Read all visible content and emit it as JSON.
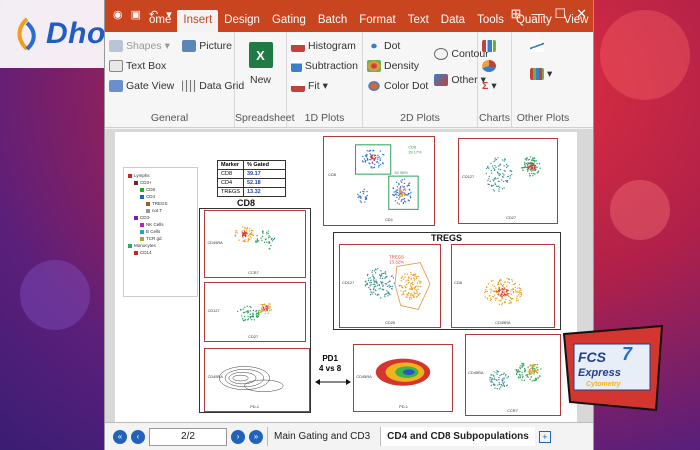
{
  "brand": {
    "name": "Dhorde"
  },
  "window": {
    "tabs": [
      "ome",
      "Insert",
      "Design",
      "Gating",
      "Batch",
      "Format",
      "Text",
      "Data",
      "Tools",
      "Quality",
      "View"
    ],
    "active_tab": "Insert",
    "controls": {
      "restore": "⊞",
      "minimize": "—",
      "maximize": "☐",
      "close": "✕"
    }
  },
  "ribbon": {
    "general": {
      "label": "General",
      "shapes": "Shapes",
      "picture": "Picture",
      "text_box": "Text Box",
      "gate_view": "Gate View",
      "data_grid": "Data Grid"
    },
    "spreadsheet": {
      "label": "Spreadsheet",
      "new": "New"
    },
    "plots1d": {
      "label": "1D Plots",
      "histogram": "Histogram",
      "subtraction": "Subtraction",
      "fit": "Fit"
    },
    "plots2d": {
      "label": "2D Plots",
      "dot": "Dot",
      "density": "Density",
      "color_dot": "Color Dot",
      "contour": "Contour",
      "other": "Other"
    },
    "charts": {
      "label": "Charts"
    },
    "other_plots": {
      "label": "Other Plots"
    }
  },
  "layout_page": {
    "tree_items": [
      "Lymphs",
      "CD3+",
      "CD8",
      "CD4",
      "TREGS",
      "not T",
      "CD3-",
      "NK Cells",
      "B Cells",
      "TCR gd",
      "Monocytes",
      "CD14"
    ],
    "stats_table": {
      "headers": [
        "Marker",
        "% Gated"
      ],
      "rows": [
        [
          "CD8",
          "39.17"
        ],
        [
          "CD4",
          "52.18"
        ],
        [
          "TREGS",
          "13.32"
        ]
      ]
    },
    "cd8_title": "CD8",
    "tregs_title": "TREGS",
    "pd1_label": [
      "PD1",
      "4 vs 8"
    ],
    "top_plot": {
      "gate1": "CD8",
      "gate1_pct": "39.17%",
      "gate2_pct": "52.58%",
      "xlabel": "CD4",
      "ylabel": "CD8"
    },
    "tregs_gate": {
      "name": "TREGS",
      "pct": "13.32%"
    },
    "axis_labels": {
      "cd45ra": "CD45RA",
      "ccr7": "CCR7",
      "cd27": "CD27",
      "cd127": "CD127",
      "cd25": "CD25",
      "pd1": "PD-1",
      "cd8": "CD8"
    }
  },
  "statusbar": {
    "page_indicator": "2/2",
    "tabs": [
      "Main Gating and CD3",
      "CD4 and CD8 Subpopulations"
    ],
    "active_tab": "CD4 and CD8 Subpopulations"
  },
  "badge": {
    "title": "FCS",
    "version": "7",
    "line2": "Express",
    "line3": "Cytometry"
  },
  "colors": {
    "titlebar": "#c9451f",
    "gate_red": "#b03a3a",
    "accent_blue": "#2262b8",
    "dot_orange": "#f39c1f",
    "dot_teal": "#3a8f8f"
  }
}
